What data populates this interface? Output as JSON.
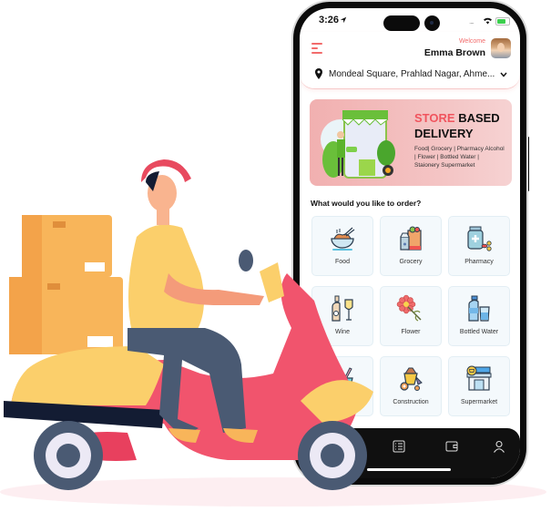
{
  "status_bar": {
    "time": "3:26",
    "location_arrow": "location-arrow-icon",
    "wifi": "wifi-icon",
    "battery": "battery-charging-icon"
  },
  "header": {
    "menu_icon": "hamburger-menu-icon",
    "welcome_label": "Welcome",
    "user_name": "Emma Brown",
    "location_icon": "map-pin-icon",
    "location": "Mondeal Square, Prahlad Nagar, Ahme...",
    "location_dropdown_icon": "chevron-down-icon"
  },
  "banner": {
    "title_highlight": "STORE",
    "title_rest": "BASED",
    "title_line2": "DELIVERY",
    "subtitle": "Food| Grocery | Pharmacy Alcohol | Flower | Bottled Water | Staionery Supermarket",
    "highlight_color": "#f0545e"
  },
  "order_section": {
    "question": "What would you like to order?",
    "categories": [
      {
        "label": "Food",
        "icon": "food-bowl-icon"
      },
      {
        "label": "Grocery",
        "icon": "grocery-bag-icon"
      },
      {
        "label": "Pharmacy",
        "icon": "medicine-icon"
      },
      {
        "label": "Wine",
        "icon": "wine-bottle-icon"
      },
      {
        "label": "Flower",
        "icon": "flower-icon"
      },
      {
        "label": "Bottled Water",
        "icon": "water-bottle-icon"
      },
      {
        "label": "",
        "icon": "stationery-basket-icon"
      },
      {
        "label": "Construction",
        "icon": "construction-cart-icon"
      },
      {
        "label": "Supermarket",
        "icon": "supermarket-store-icon"
      }
    ]
  },
  "bottom_nav": {
    "items": [
      {
        "icon": "orders-list-icon"
      },
      {
        "icon": "wallet-icon"
      },
      {
        "icon": "profile-icon"
      }
    ]
  },
  "illustration": {
    "subject": "delivery rider on scooter with parcel boxes",
    "colors": {
      "scooter": "#f1546d",
      "shirt": "#fbcf6b",
      "cap": "#e84a5f",
      "boxes": "#f8b55a",
      "pants": "#4a5a73"
    }
  }
}
